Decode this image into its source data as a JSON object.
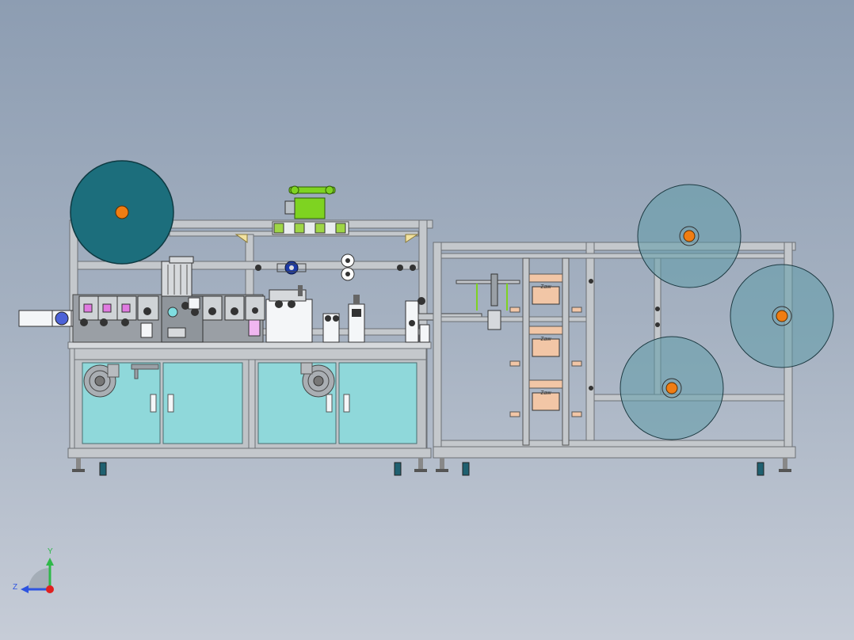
{
  "viewport": {
    "background_top": "#8d9db2",
    "background_bottom": "#c6ccd7"
  },
  "model": {
    "frame_color": "#c4c8cc",
    "frame_edge": "#6b6f74",
    "teal_roll_color": "#1c6e7c",
    "translucent_roll_color": "#5f9aa8",
    "hub_color": "#f07d12",
    "panel_glass_color": "#8fd8da",
    "motor_green": "#7ed321",
    "label_tags": [
      "Zaw",
      "Zaw",
      "Zaw"
    ]
  },
  "triad": {
    "y_label": "Y",
    "z_label": "Z",
    "y_color": "#2fb84a",
    "z_color": "#2e54e0",
    "x_color": "#e02020",
    "icon": "coordinate-triad-icon"
  }
}
